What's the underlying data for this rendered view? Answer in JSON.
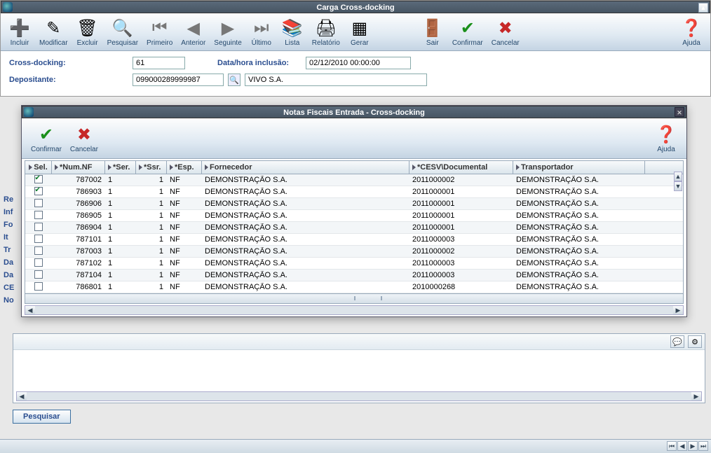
{
  "main": {
    "title": "Carga Cross-docking",
    "toolbar": {
      "incluir": "Incluir",
      "modificar": "Modificar",
      "excluir": "Excluir",
      "pesquisar": "Pesquisar",
      "primeiro": "Primeiro",
      "anterior": "Anterior",
      "seguinte": "Seguinte",
      "ultimo": "Último",
      "lista": "Lista",
      "relatorio": "Relatório",
      "gerar": "Gerar",
      "sair": "Sair",
      "confirmar": "Confirmar",
      "cancelar": "Cancelar",
      "ajuda": "Ajuda"
    },
    "form": {
      "cross_docking_label": "Cross-docking:",
      "cross_docking_value": "61",
      "data_label": "Data/hora inclusão:",
      "data_value": "02/12/2010 00:00:00",
      "depositante_label": "Depositante:",
      "depositante_code": "099000289999987",
      "depositante_name": "VIVO S.A."
    },
    "side": [
      "Re",
      "Inf",
      "Fo",
      "It",
      "Tr",
      "Da",
      "Da",
      "CE",
      "No"
    ]
  },
  "modal": {
    "title": "Notas Fiscais Entrada - Cross-docking",
    "toolbar": {
      "confirmar": "Confirmar",
      "cancelar": "Cancelar",
      "ajuda": "Ajuda"
    },
    "headers": {
      "sel": "Sel.",
      "nf": "*Num.NF",
      "ser": "*Ser.",
      "ssr": "*Ssr.",
      "esp": "*Esp.",
      "fornecedor": "Fornecedor",
      "cesv": "*CESV\\Documental",
      "transportador": "Transportador"
    },
    "rows": [
      {
        "sel": true,
        "nf": "787002",
        "ser": "1",
        "ssr": "1",
        "esp": "NF",
        "forn": "DEMONSTRAÇÃO S.A.",
        "cesv": "2011000002",
        "trans": "DEMONSTRAÇÃO S.A."
      },
      {
        "sel": true,
        "nf": "786903",
        "ser": "1",
        "ssr": "1",
        "esp": "NF",
        "forn": "DEMONSTRAÇÃO S.A.",
        "cesv": "2011000001",
        "trans": "DEMONSTRAÇÃO S.A."
      },
      {
        "sel": false,
        "nf": "786906",
        "ser": "1",
        "ssr": "1",
        "esp": "NF",
        "forn": "DEMONSTRAÇÃO S.A.",
        "cesv": "2011000001",
        "trans": "DEMONSTRAÇÃO S.A."
      },
      {
        "sel": false,
        "nf": "786905",
        "ser": "1",
        "ssr": "1",
        "esp": "NF",
        "forn": "DEMONSTRAÇÃO S.A.",
        "cesv": "2011000001",
        "trans": "DEMONSTRAÇÃO S.A."
      },
      {
        "sel": false,
        "nf": "786904",
        "ser": "1",
        "ssr": "1",
        "esp": "NF",
        "forn": "DEMONSTRAÇÃO S.A.",
        "cesv": "2011000001",
        "trans": "DEMONSTRAÇÃO S.A."
      },
      {
        "sel": false,
        "nf": "787101",
        "ser": "1",
        "ssr": "1",
        "esp": "NF",
        "forn": "DEMONSTRAÇÃO S.A.",
        "cesv": "2011000003",
        "trans": "DEMONSTRAÇÃO S.A."
      },
      {
        "sel": false,
        "nf": "787003",
        "ser": "1",
        "ssr": "1",
        "esp": "NF",
        "forn": "DEMONSTRAÇÃO S.A.",
        "cesv": "2011000002",
        "trans": "DEMONSTRAÇÃO S.A."
      },
      {
        "sel": false,
        "nf": "787102",
        "ser": "1",
        "ssr": "1",
        "esp": "NF",
        "forn": "DEMONSTRAÇÃO S.A.",
        "cesv": "2011000003",
        "trans": "DEMONSTRAÇÃO S.A."
      },
      {
        "sel": false,
        "nf": "787104",
        "ser": "1",
        "ssr": "1",
        "esp": "NF",
        "forn": "DEMONSTRAÇÃO S.A.",
        "cesv": "2011000003",
        "trans": "DEMONSTRAÇÃO S.A."
      },
      {
        "sel": false,
        "nf": "786801",
        "ser": "1",
        "ssr": "1",
        "esp": "NF",
        "forn": "DEMONSTRAÇÃO S.A.",
        "cesv": "2010000268",
        "trans": "DEMONSTRAÇÃO S.A."
      }
    ]
  },
  "bottom": {
    "pesquisar": "Pesquisar"
  }
}
